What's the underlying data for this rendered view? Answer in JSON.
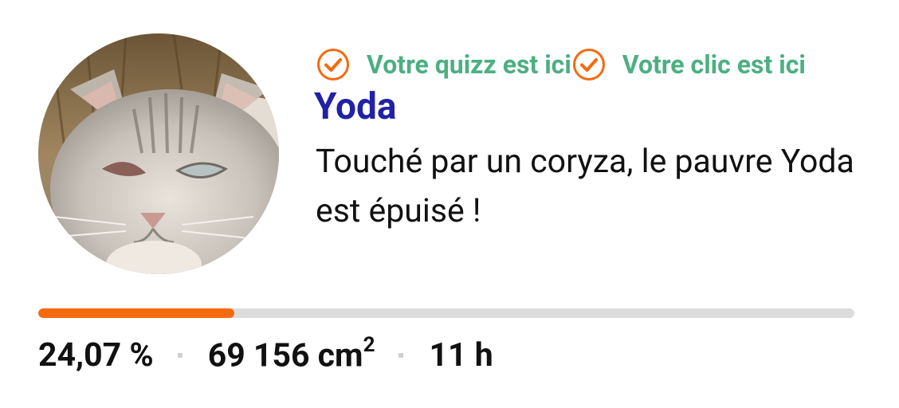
{
  "card": {
    "avatar_alt": "Photo de Yoda",
    "badges": [
      {
        "icon": "check-circle-icon",
        "label": "Votre quizz est ici"
      },
      {
        "icon": "check-circle-icon",
        "label": "Votre clic est ici"
      }
    ],
    "name": "Yoda",
    "description": "Touché par un coryza, le pauvre Yoda est épuisé !",
    "progress_fraction": 0.2407,
    "stats": {
      "percent": "24,07 %",
      "area_value": "69 156 cm",
      "area_exponent": "2",
      "time": "11 h"
    }
  },
  "colors": {
    "name": "#2121a8",
    "badge_text": "#4caf82",
    "badge_icon": "#f56a0e",
    "progress_fill": "#f56a0e",
    "progress_track": "#dcdcdc"
  }
}
